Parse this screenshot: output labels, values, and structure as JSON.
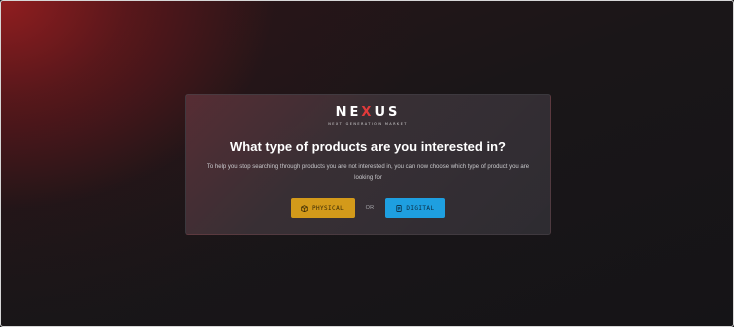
{
  "logo": {
    "name_part1": "NE",
    "name_x": "X",
    "name_part2": "US",
    "tagline": "NEXT GENERATION MARKET"
  },
  "modal": {
    "title": "What type of products are you interested in?",
    "description": "To help you stop searching through products you are not interested in, you can now choose which type of product you are looking for"
  },
  "choices": {
    "physical_label": "PHYSICAL",
    "or_label": "OR",
    "digital_label": "DIGITAL"
  },
  "icons": {
    "physical": "box-icon",
    "digital": "document-icon"
  },
  "colors": {
    "physical_button": "#d39a1a",
    "digital_button": "#1e9fe0",
    "logo_accent": "#e23a3a"
  }
}
